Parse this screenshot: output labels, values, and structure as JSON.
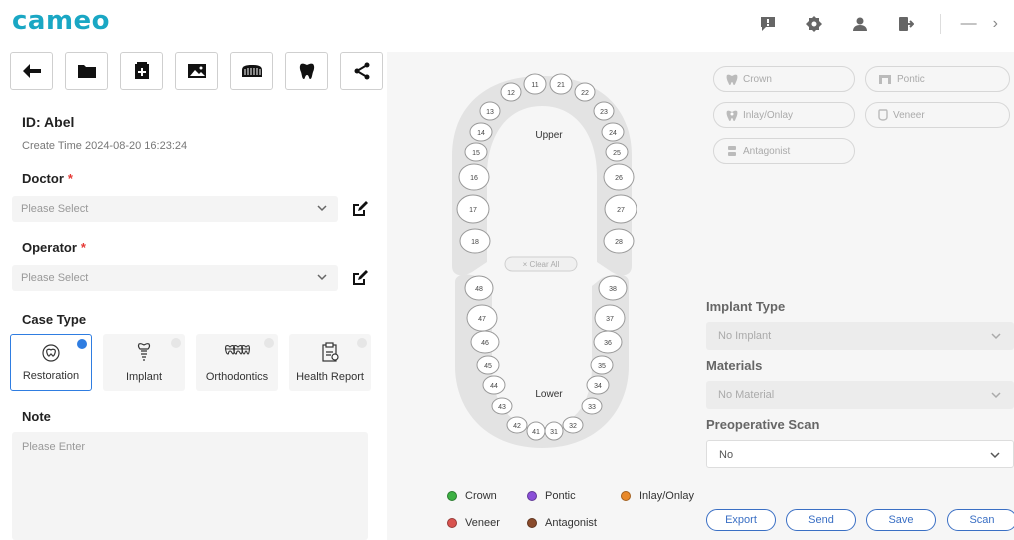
{
  "app": {
    "logo": "cameo"
  },
  "case": {
    "id_label": "ID: Abel",
    "create_time": "Create Time 2024-08-20 16:23:24"
  },
  "doctor": {
    "label": "Doctor",
    "required": "*",
    "placeholder": "Please Select"
  },
  "operator": {
    "label": "Operator",
    "required": "*",
    "placeholder": "Please Select"
  },
  "case_type": {
    "label": "Case Type",
    "options": [
      {
        "label": "Restoration",
        "selected": true
      },
      {
        "label": "Implant",
        "selected": false
      },
      {
        "label": "Orthodontics",
        "selected": false
      },
      {
        "label": "Health Report",
        "selected": false
      }
    ]
  },
  "note": {
    "label": "Note",
    "placeholder": "Please Enter"
  },
  "tooth_chart": {
    "upper_label": "Upper",
    "lower_label": "Lower",
    "clear_all": "× Clear All",
    "upper_teeth": [
      "11",
      "12",
      "13",
      "14",
      "15",
      "16",
      "17",
      "18",
      "21",
      "22",
      "23",
      "24",
      "25",
      "26",
      "27",
      "28"
    ],
    "lower_teeth": [
      "31",
      "32",
      "33",
      "34",
      "35",
      "36",
      "37",
      "38",
      "41",
      "42",
      "43",
      "44",
      "45",
      "46",
      "47",
      "48"
    ]
  },
  "restoration_types": {
    "crown": "Crown",
    "pontic": "Pontic",
    "inlay_onlay": "Inlay/Onlay",
    "veneer": "Veneer",
    "antagonist": "Antagonist"
  },
  "implant_type": {
    "label": "Implant Type",
    "value": "No Implant"
  },
  "materials": {
    "label": "Materials",
    "value": "No Material"
  },
  "preoperative_scan": {
    "label": "Preoperative Scan",
    "value": "No"
  },
  "legend": [
    {
      "label": "Crown",
      "color": "#3cb043"
    },
    {
      "label": "Pontic",
      "color": "#8a4fd8"
    },
    {
      "label": "Inlay/Onlay",
      "color": "#e8892a"
    },
    {
      "label": "Veneer",
      "color": "#d9534f"
    },
    {
      "label": "Antagonist",
      "color": "#8a4b2c"
    }
  ],
  "actions": {
    "export": "Export",
    "send": "Send",
    "save": "Save",
    "scan": "Scan"
  },
  "colors": {
    "brand": "#1aa7c4",
    "accent": "#2f7de1",
    "required": "#e53935"
  }
}
